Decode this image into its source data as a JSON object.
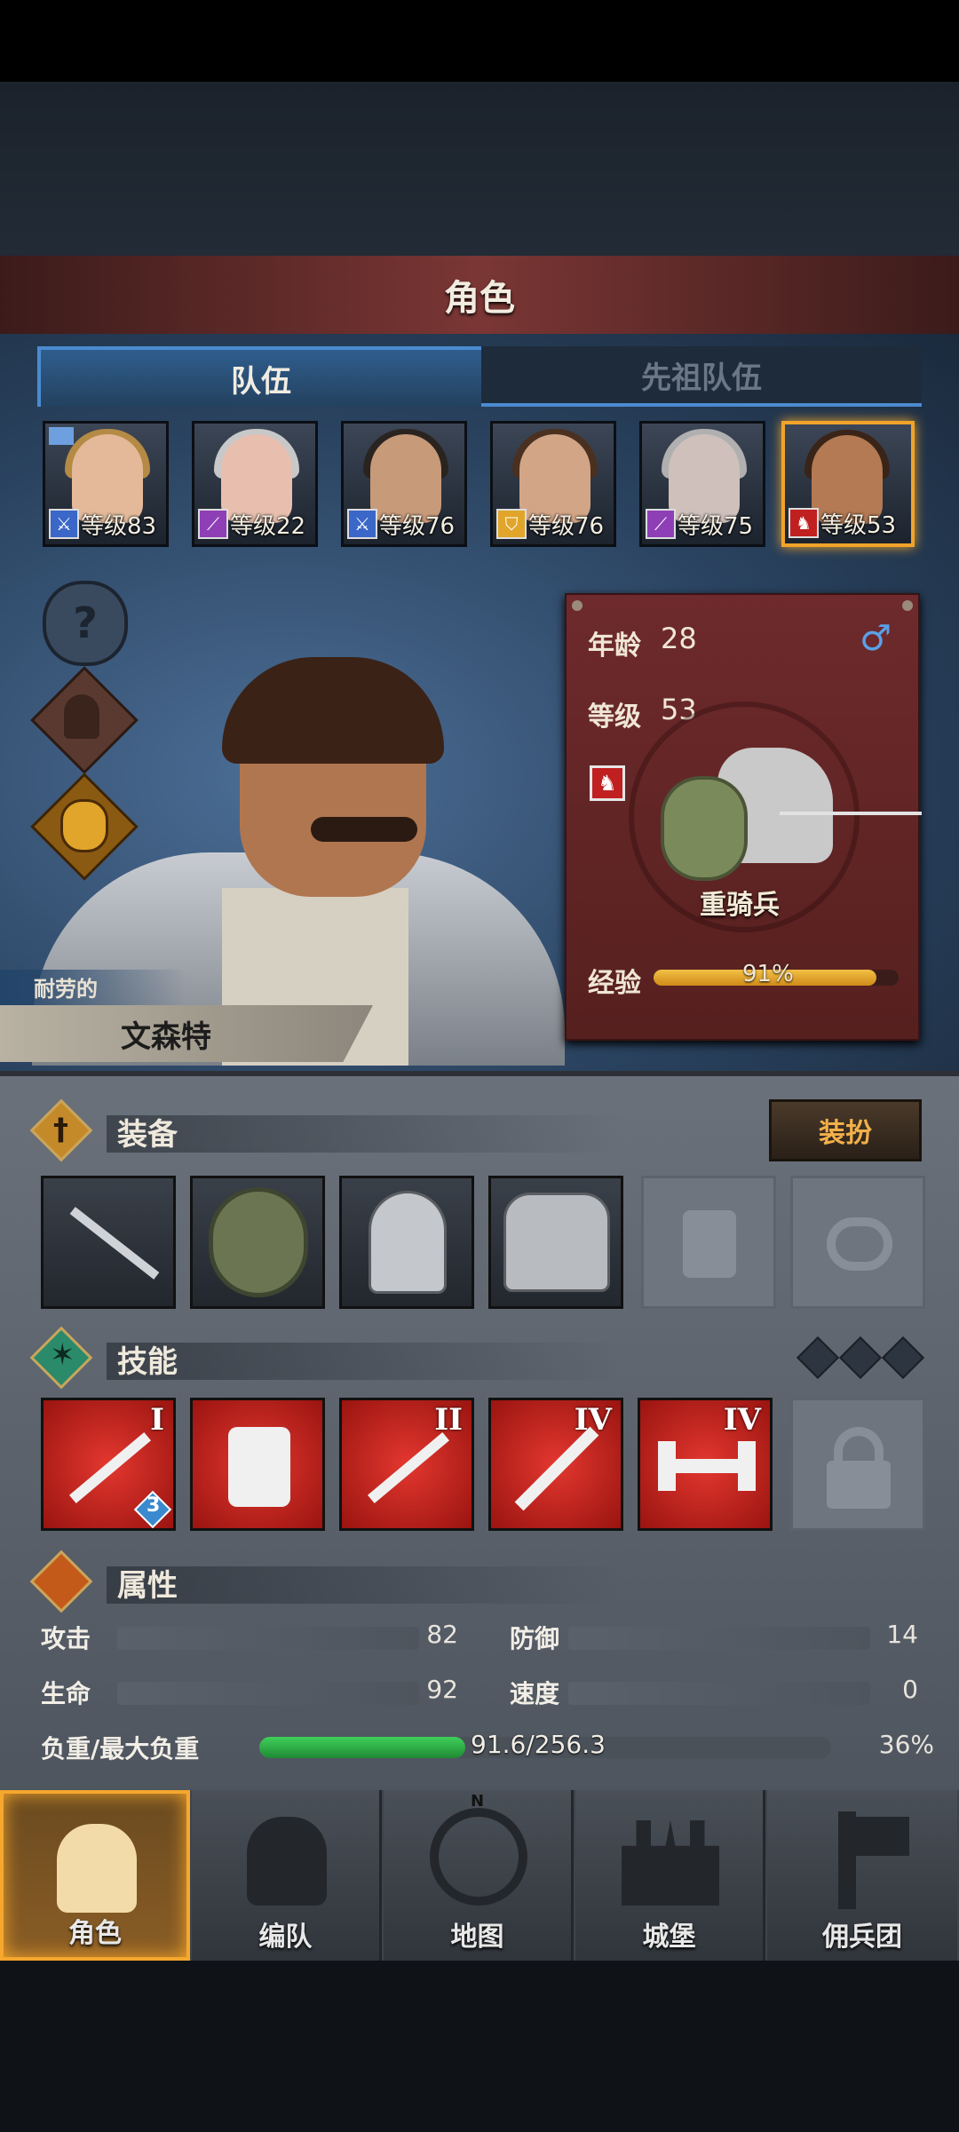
{
  "header": {
    "title": "角色"
  },
  "tabs": [
    {
      "label": "队伍",
      "active": true
    },
    {
      "label": "先祖队伍",
      "active": false
    }
  ],
  "roster": [
    {
      "level_text": "等级83",
      "class_icon": "sword-icon",
      "class_color": "#3a67c8",
      "hair_color": "#b58a45",
      "skin_color": "#e3b99a",
      "selected": false
    },
    {
      "level_text": "等级22",
      "class_icon": "staff-icon",
      "class_color": "#8e3fb6",
      "hair_color": "#c8c8c8",
      "skin_color": "#e8bfae",
      "selected": false
    },
    {
      "level_text": "等级76",
      "class_icon": "sword-icon",
      "class_color": "#3a67c8",
      "hair_color": "#2a2420",
      "skin_color": "#c79a7a",
      "selected": false
    },
    {
      "level_text": "等级76",
      "class_icon": "shield-icon",
      "class_color": "#e0a52a",
      "hair_color": "#4a3020",
      "skin_color": "#d2a587",
      "selected": false
    },
    {
      "level_text": "等级75",
      "class_icon": "staff-icon",
      "class_color": "#8e3fb6",
      "hair_color": "#b0b0b0",
      "skin_color": "#cfc0bb",
      "selected": false
    },
    {
      "level_text": "等级53",
      "class_icon": "horse-icon",
      "class_color": "#c02020",
      "hair_color": "#3a2418",
      "skin_color": "#b37a54",
      "selected": true
    }
  ],
  "character": {
    "trait": "耐劳的",
    "name": "文森特",
    "age_label": "年龄",
    "age": "28",
    "gender_icon": "male-icon",
    "level_label": "等级",
    "level": "53",
    "class_name": "重骑兵",
    "exp_label": "经验",
    "exp_text": "91%",
    "exp_fraction": 0.91
  },
  "equipment": {
    "title": "装备",
    "dress_button": "装扮",
    "slots": [
      {
        "icon": "spear-icon",
        "filled": true
      },
      {
        "icon": "round-shield-icon",
        "filled": true
      },
      {
        "icon": "helmet-icon",
        "filled": true
      },
      {
        "icon": "armor-icon",
        "filled": true
      },
      {
        "icon": "boots-icon",
        "filled": false
      },
      {
        "icon": "ring-icon",
        "filled": false
      }
    ]
  },
  "skills": {
    "title": "技能",
    "slots": [
      {
        "icon": "sword-cursor-icon",
        "rank": "I",
        "badge": "3"
      },
      {
        "icon": "fist-weight-icon",
        "rank": "",
        "badge": ""
      },
      {
        "icon": "sword-cursor-icon",
        "rank": "II",
        "badge": ""
      },
      {
        "icon": "sword-icon",
        "rank": "IV",
        "badge": ""
      },
      {
        "icon": "dumbbell-icon",
        "rank": "IV",
        "badge": ""
      },
      {
        "icon": "lock-icon",
        "rank": "",
        "badge": "",
        "locked": true
      }
    ]
  },
  "attributes": {
    "title": "属性",
    "attack_label": "攻击",
    "attack": "82",
    "defense_label": "防御",
    "defense": "14",
    "hp_label": "生命",
    "hp": "92",
    "speed_label": "速度",
    "speed": "0",
    "weight_label": "负重/最大负重",
    "weight_text": "91.6/256.3",
    "weight_percent": "36%",
    "weight_fraction": 0.36
  },
  "nav": [
    {
      "label": "角色",
      "icon": "knight-icon",
      "active": true
    },
    {
      "label": "编队",
      "icon": "helmet-group-icon",
      "active": false
    },
    {
      "label": "地图",
      "icon": "compass-icon",
      "active": false
    },
    {
      "label": "城堡",
      "icon": "castle-icon",
      "active": false
    },
    {
      "label": "佣兵团",
      "icon": "banner-icon",
      "active": false
    }
  ]
}
